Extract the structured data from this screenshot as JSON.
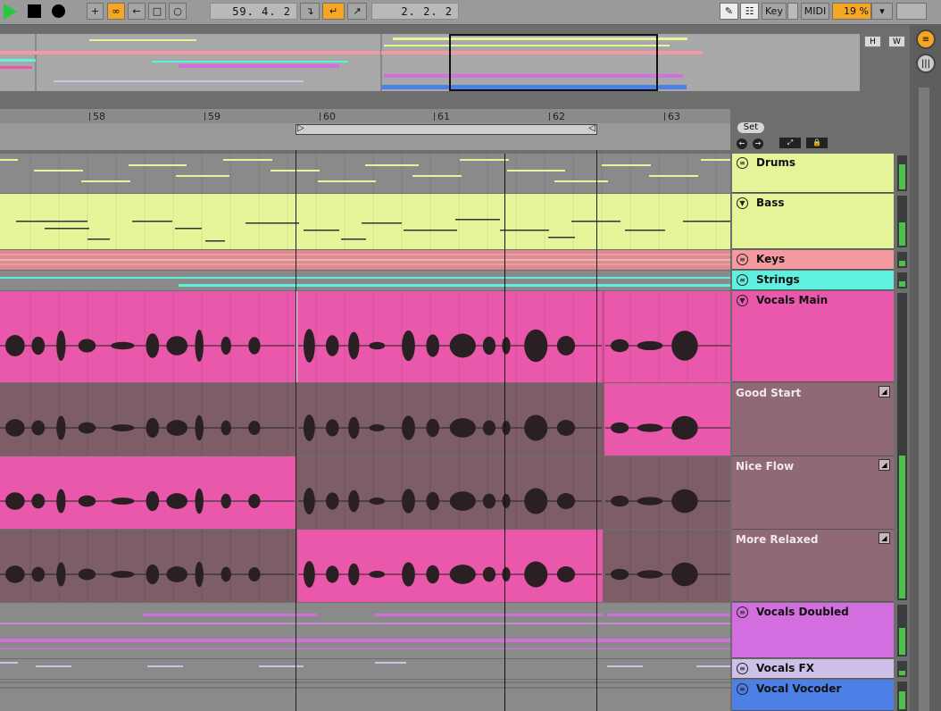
{
  "transport": {
    "play_icon": "play-icon",
    "stop_icon": "stop-icon",
    "record_icon": "record-icon"
  },
  "toolbar": {
    "position": "59.  4.  2",
    "loop_length": "2.  2.  2",
    "key_label": "Key",
    "midi_label": "MIDI",
    "cpu": "19 %"
  },
  "overview": {
    "h_button": "H",
    "w_button": "W"
  },
  "ruler": {
    "bars": [
      "58",
      "59",
      "60",
      "61",
      "62",
      "63"
    ]
  },
  "set_label": "Set",
  "tracks": [
    {
      "name": "Drums",
      "color": "#e6f59a",
      "type": "midi"
    },
    {
      "name": "Bass",
      "color": "#e6f59a",
      "type": "midi"
    },
    {
      "name": "Keys",
      "color": "#f49aa0",
      "type": "midi"
    },
    {
      "name": "Strings",
      "color": "#5ff0e0",
      "type": "midi"
    },
    {
      "name": "Vocals Main",
      "color": "#ea58ab",
      "type": "audio"
    },
    {
      "name": "Vocals Doubled",
      "color": "#d36ee0",
      "type": "midi"
    },
    {
      "name": "Vocals FX",
      "color": "#cfc0e8",
      "type": "midi"
    },
    {
      "name": "Vocal Vocoder",
      "color": "#4c80e6",
      "type": "midi"
    }
  ],
  "takes": [
    {
      "name": "Good Start"
    },
    {
      "name": "Nice Flow"
    },
    {
      "name": "More Relaxed"
    }
  ],
  "colors": {
    "accent": "#f5a623",
    "active_take": "#ea58ab",
    "inactive_take": "#7e5e66"
  }
}
